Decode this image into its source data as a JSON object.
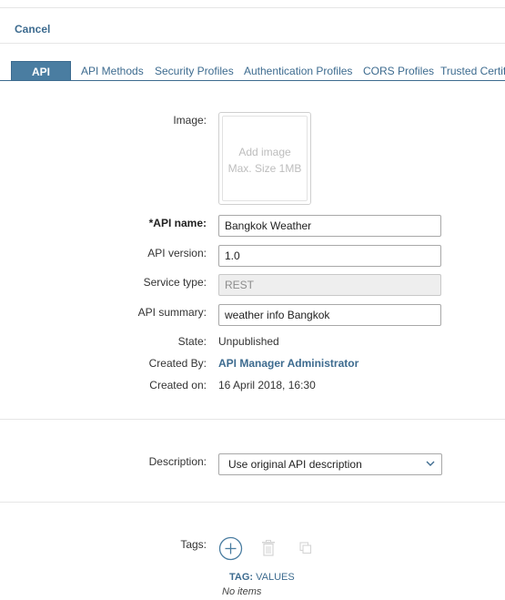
{
  "header": {
    "cancel_label": "Cancel"
  },
  "tabs": [
    {
      "label": "API",
      "active": true
    },
    {
      "label": "API Methods"
    },
    {
      "label": "Security Profiles"
    },
    {
      "label": "Authentication Profiles"
    },
    {
      "label": "CORS Profiles"
    },
    {
      "label": "Trusted Certifi"
    }
  ],
  "form": {
    "image": {
      "label": "Image:",
      "placeholder_line1": "Add image",
      "placeholder_line2": "Max. Size 1MB"
    },
    "api_name": {
      "label": "*API name:",
      "value": "Bangkok Weather"
    },
    "api_version": {
      "label": "API version:",
      "value": "1.0"
    },
    "service_type": {
      "label": "Service type:",
      "value": "REST"
    },
    "api_summary": {
      "label": "API summary:",
      "value": "weather info Bangkok"
    },
    "state": {
      "label": "State:",
      "value": "Unpublished"
    },
    "created_by": {
      "label": "Created By:",
      "value": "API Manager Administrator"
    },
    "created_on": {
      "label": "Created on:",
      "value": "16 April 2018, 16:30"
    },
    "description": {
      "label": "Description:",
      "selected": "Use original API description"
    },
    "tags": {
      "label": "Tags:",
      "column_tag": "TAG:",
      "column_values": "VALUES",
      "empty_text": "No items",
      "icons": [
        "add-icon",
        "trash-icon",
        "copy-icon"
      ]
    }
  },
  "colors": {
    "accent": "#3d6b8f",
    "active_tab_bg": "#4a7da1"
  }
}
